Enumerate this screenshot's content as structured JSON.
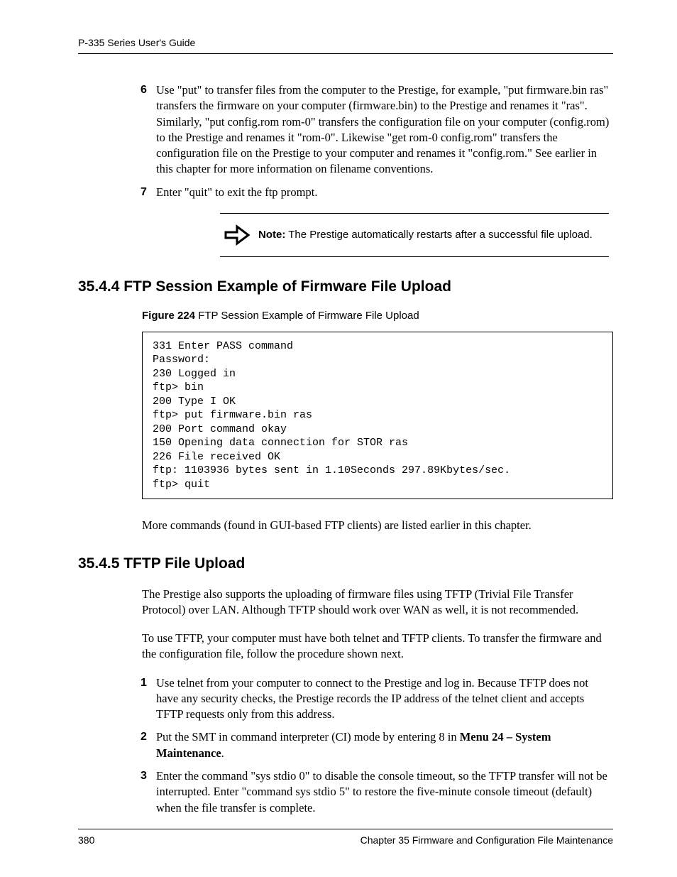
{
  "header": {
    "title": "P-335 Series User's Guide"
  },
  "steps_a": [
    {
      "num": "6",
      "text": "Use \"put\" to transfer files from the computer to the Prestige, for example, \"put firmware.bin ras\" transfers the firmware on your computer (firmware.bin) to the Prestige and renames it \"ras\". Similarly, \"put config.rom rom-0\" transfers the configuration file on your computer (config.rom) to the Prestige and renames it \"rom-0\". Likewise \"get rom-0 config.rom\" transfers the configuration file on the Prestige to your computer and renames it \"config.rom.\" See earlier in this chapter for more information on filename conventions."
    },
    {
      "num": "7",
      "text": "Enter \"quit\" to exit the ftp prompt."
    }
  ],
  "note": {
    "label": "Note:",
    "text": " The Prestige automatically restarts after a successful file upload."
  },
  "section_3544": {
    "heading": "35.4.4  FTP Session Example of Firmware File Upload",
    "figure_label": "Figure 224",
    "figure_caption": "   FTP Session Example of Firmware File Upload",
    "code": "331 Enter PASS command\nPassword:\n230 Logged in\nftp> bin\n200 Type I OK\nftp> put firmware.bin ras\n200 Port command okay\n150 Opening data connection for STOR ras\n226 File received OK\nftp: 1103936 bytes sent in 1.10Seconds 297.89Kbytes/sec.\nftp> quit",
    "after_code": "More commands (found in GUI-based FTP clients) are listed earlier in this chapter."
  },
  "section_3545": {
    "heading": "35.4.5  TFTP File Upload",
    "para1": "The Prestige also supports the uploading of firmware files using TFTP (Trivial File Transfer Protocol) over LAN. Although TFTP should work over WAN as well, it is not recommended.",
    "para2": "To use TFTP, your computer must have both telnet and TFTP clients. To transfer the firmware and the configuration file, follow the procedure shown next.",
    "steps": [
      {
        "num": "1",
        "text": "Use telnet from your computer to connect to the Prestige and log in. Because TFTP does not have any security checks, the Prestige records the IP address of the telnet client and accepts TFTP requests only from this address."
      },
      {
        "num": "2",
        "text_before": "Put the SMT in command interpreter (CI) mode by entering 8 in ",
        "bold": "Menu 24 – System Maintenance",
        "text_after": "."
      },
      {
        "num": "3",
        "text": "Enter the command \"sys stdio 0\" to disable the console timeout, so the TFTP transfer will not be interrupted. Enter \"command sys stdio 5\" to restore the five-minute console timeout (default) when the file transfer is complete."
      }
    ]
  },
  "footer": {
    "page": "380",
    "chapter": "Chapter 35 Firmware and Configuration File Maintenance"
  }
}
